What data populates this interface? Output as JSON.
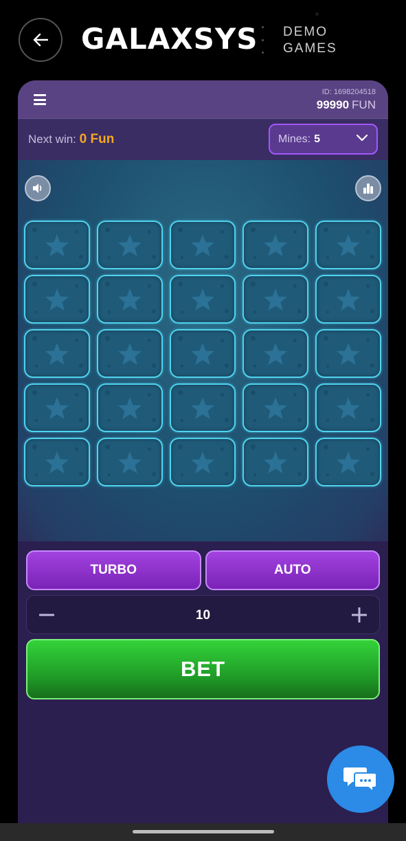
{
  "topbar": {
    "brand": "GALAXSYS",
    "demo_line1": "DEMO",
    "demo_line2": "GAMES",
    "back_icon": "arrow-left-icon"
  },
  "header": {
    "account_id": "ID: 1698204518",
    "balance_amount": "99990",
    "balance_unit": "FUN",
    "menu_icon": "hamburger-menu-icon"
  },
  "info_bar": {
    "next_win_label": "Next win:",
    "next_win_value": "0 Fun",
    "mines_label": "Mines:",
    "mines_value": "5"
  },
  "board": {
    "sound_icon": "speaker-icon",
    "stats_icon": "bar-chart-icon",
    "rows": 5,
    "columns": 5,
    "tile_icon": "star-icon"
  },
  "controls": {
    "turbo_label": "TURBO",
    "auto_label": "AUTO",
    "bet_amount": "10",
    "bet_label": "BET"
  },
  "chat": {
    "icon": "chat-bubble-icon"
  },
  "colors": {
    "accent_purple": "#a243e0",
    "bet_green": "#2bbf33",
    "next_win_orange": "#f5a623",
    "tile_border": "#4fd3ef"
  }
}
